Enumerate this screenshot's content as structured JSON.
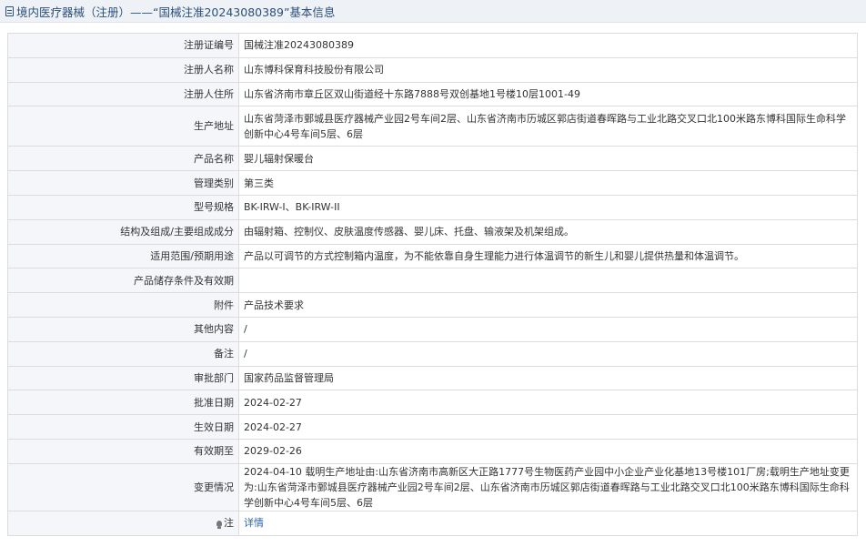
{
  "header": {
    "title": "境内医疗器械（注册）——“国械注准20243080389”基本信息"
  },
  "rows": [
    {
      "label": "注册证编号",
      "value": "国械注准20243080389"
    },
    {
      "label": "注册人名称",
      "value": "山东博科保育科技股份有限公司"
    },
    {
      "label": "注册人住所",
      "value": "山东省济南市章丘区双山街道经十东路7888号双创基地1号楼10层1001-49"
    },
    {
      "label": "生产地址",
      "value": "山东省菏泽市鄄城县医疗器械产业园2号车间2层、山东省济南市历城区郭店街道春晖路与工业北路交叉口北100米路东博科国际生命科学创新中心4号车间5层、6层"
    },
    {
      "label": "产品名称",
      "value": "婴儿辐射保暖台"
    },
    {
      "label": "管理类别",
      "value": "第三类"
    },
    {
      "label": "型号规格",
      "value": "BK-IRW-I、BK-IRW-II"
    },
    {
      "label": "结构及组成/主要组成成分",
      "value": "由辐射箱、控制仪、皮肤温度传感器、婴儿床、托盘、输液架及机架组成。"
    },
    {
      "label": "适用范围/预期用途",
      "value": "产品以可调节的方式控制箱内温度，为不能依靠自身生理能力进行体温调节的新生儿和婴儿提供热量和体温调节。"
    },
    {
      "label": "产品储存条件及有效期",
      "value": ""
    },
    {
      "label": "附件",
      "value": "产品技术要求"
    },
    {
      "label": "其他内容",
      "value": "/"
    },
    {
      "label": "备注",
      "value": "/"
    },
    {
      "label": "审批部门",
      "value": "国家药品监督管理局"
    },
    {
      "label": "批准日期",
      "value": "2024-02-27"
    },
    {
      "label": "生效日期",
      "value": "2024-02-27"
    },
    {
      "label": "有效期至",
      "value": "2029-02-26"
    },
    {
      "label": "变更情况",
      "value": "2024-04-10 载明生产地址由:山东省济南市高新区大正路1777号生物医药产业园中小企业产业化基地13号楼101厂房;载明生产地址变更为:山东省菏泽市鄄城县医疗器械产业园2号车间2层、山东省济南市历城区郭店街道春晖路与工业北路交叉口北100米路东博科国际生命科学创新中心4号车间5层、6层"
    }
  ],
  "note": {
    "label": "注",
    "link": "详情"
  }
}
